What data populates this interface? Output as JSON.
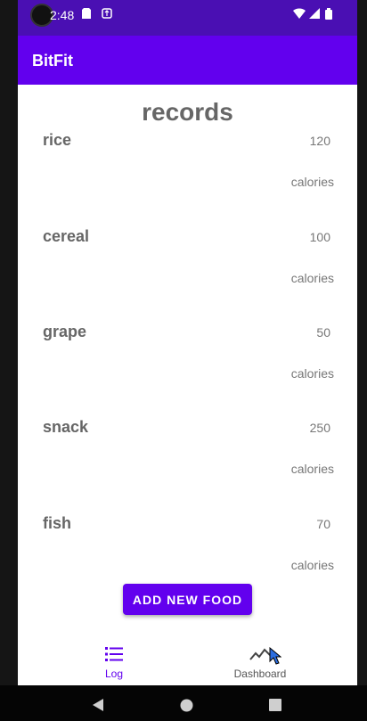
{
  "status_bar": {
    "time": "2:48",
    "icons": [
      "sd-card-icon",
      "usb-icon",
      "wifi-icon",
      "signal-icon",
      "battery-icon"
    ]
  },
  "app_bar": {
    "title": "BitFit"
  },
  "main": {
    "title": "records",
    "records": [
      {
        "name": "rice",
        "value": "120",
        "unit": "calories"
      },
      {
        "name": "cereal",
        "value": "100",
        "unit": "calories"
      },
      {
        "name": "grape",
        "value": "50",
        "unit": "calories"
      },
      {
        "name": "snack",
        "value": "250",
        "unit": "calories"
      },
      {
        "name": "fish",
        "value": "70",
        "unit": "calories"
      }
    ],
    "add_button_label": "ADD NEW FOOD"
  },
  "bottom_nav": {
    "items": [
      {
        "label": "Log",
        "icon": "list-icon",
        "active": true
      },
      {
        "label": "Dashboard",
        "icon": "chart-line-icon",
        "active": false
      }
    ]
  },
  "colors": {
    "primary": "#6200ee",
    "status_bar": "#4a0fb3",
    "text_gray": "#666666"
  }
}
